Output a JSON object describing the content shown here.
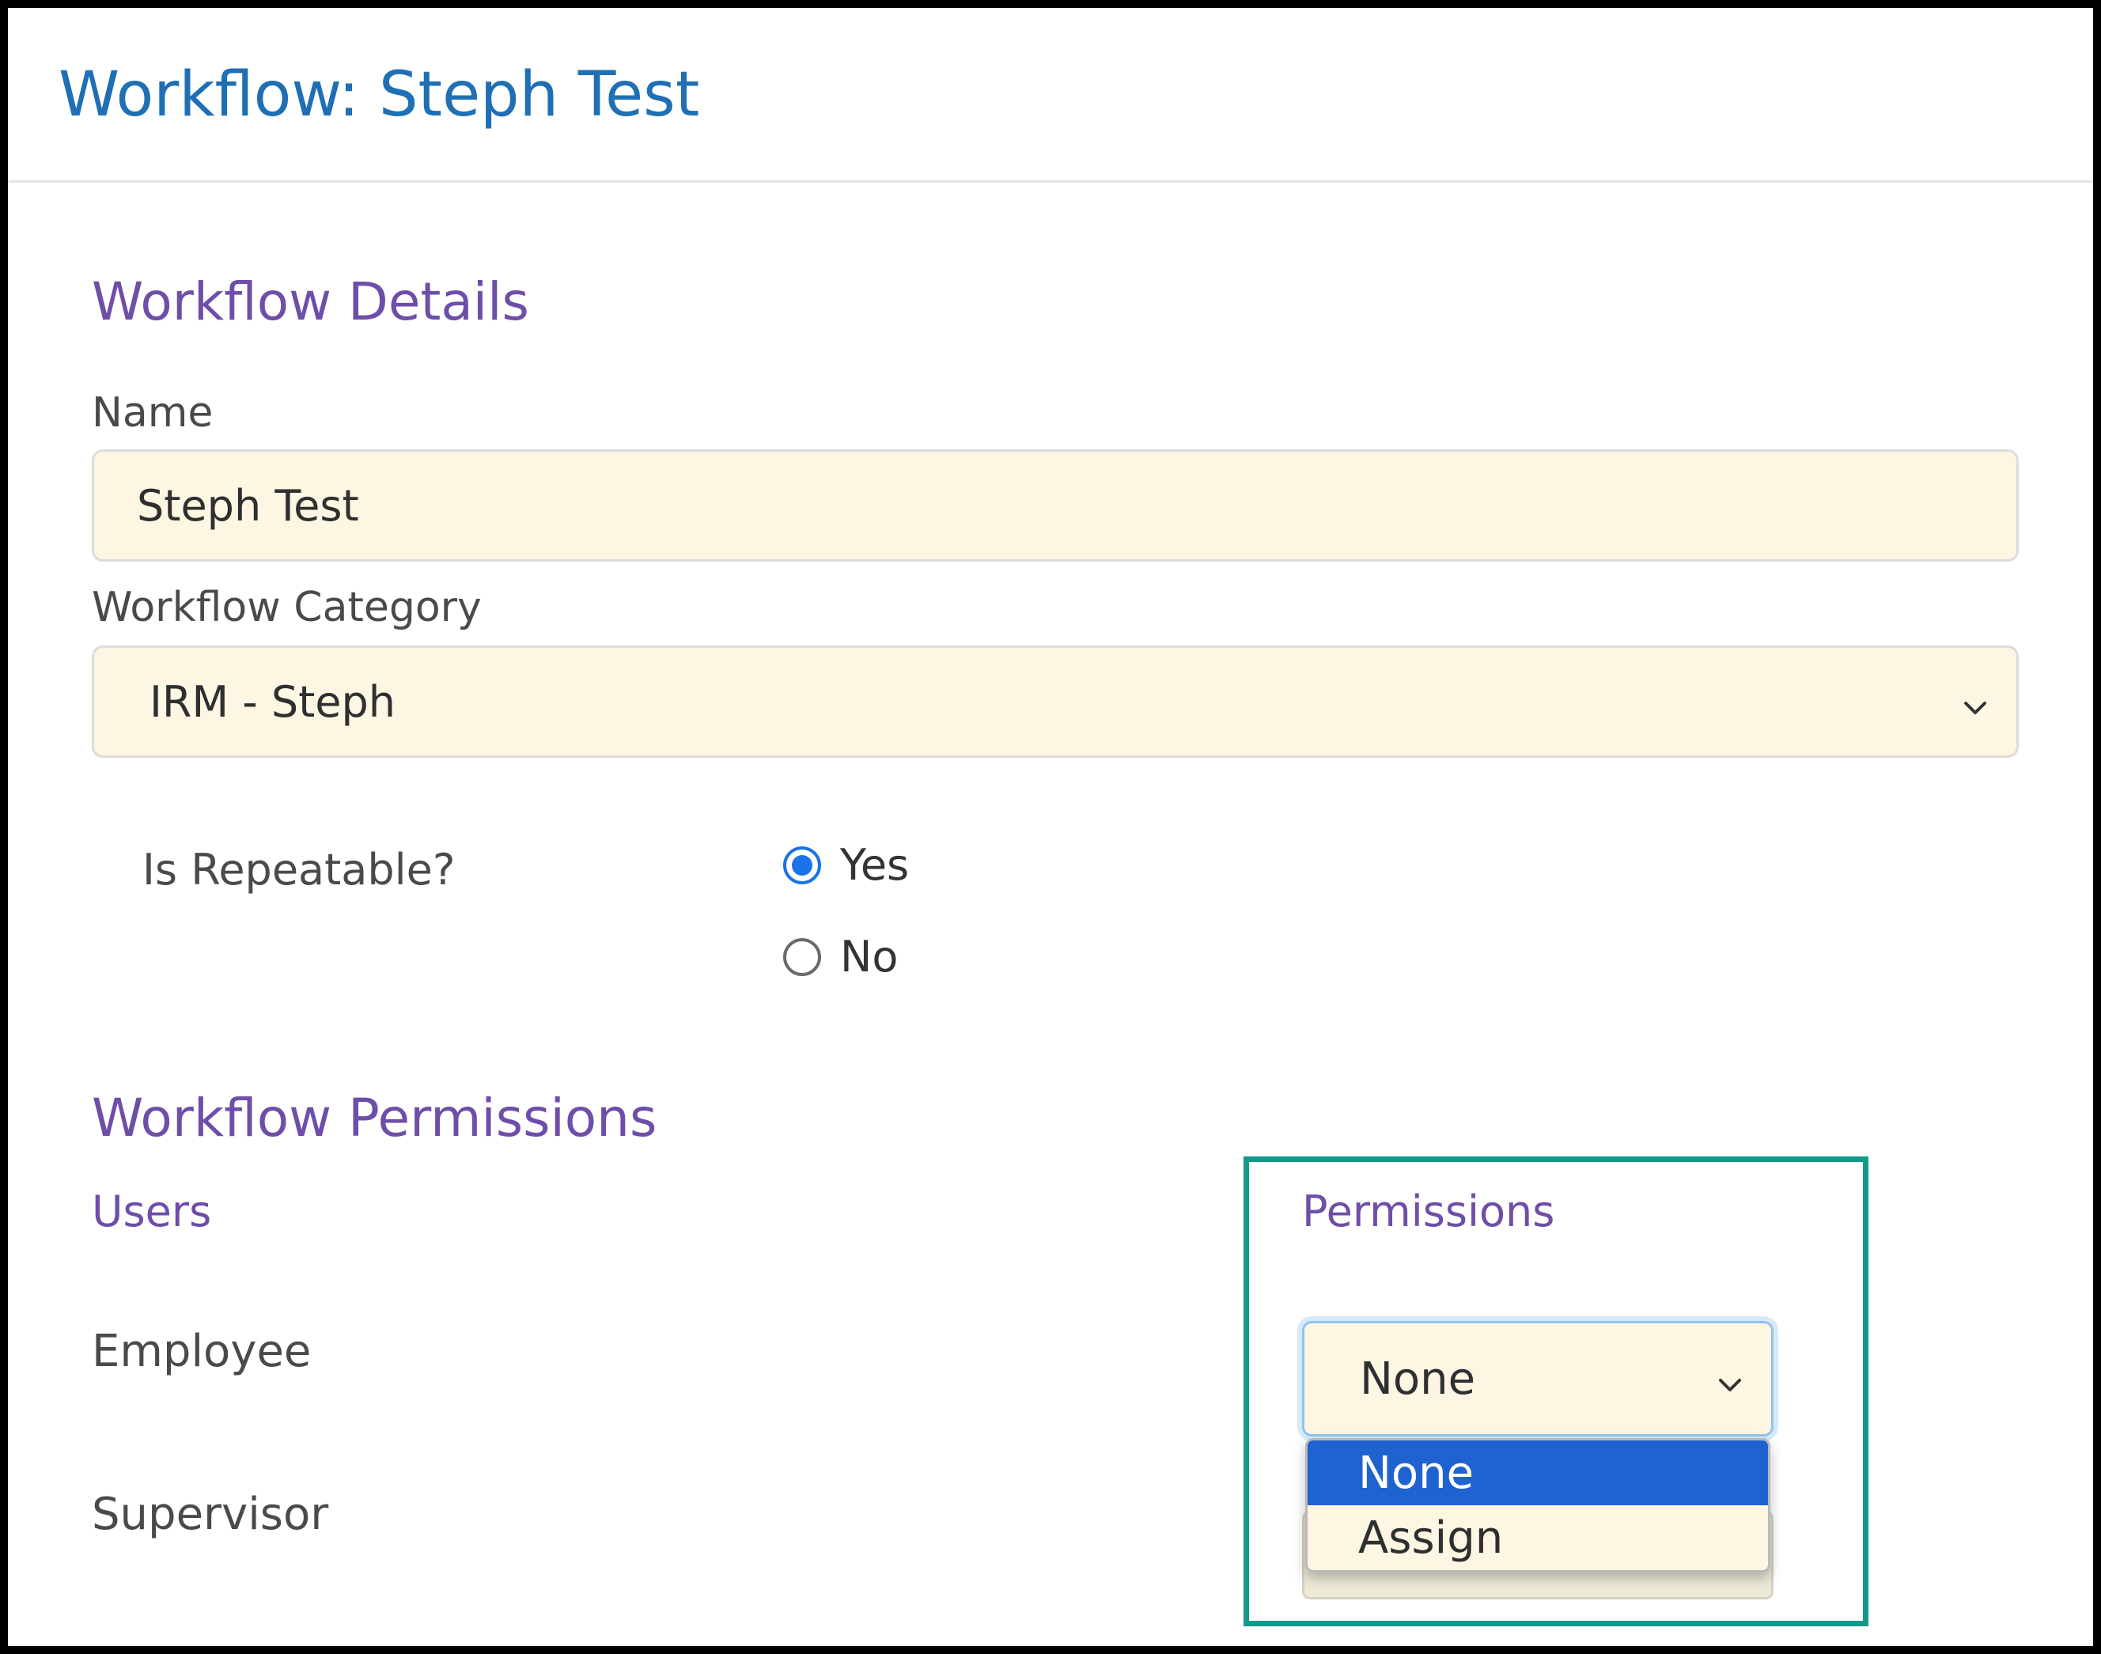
{
  "header": {
    "title": "Workflow: Steph Test"
  },
  "details": {
    "heading": "Workflow Details",
    "name_label": "Name",
    "name_value": "Steph Test",
    "category_label": "Workflow Category",
    "category_value": "IRM - Steph",
    "repeatable_label": "Is Repeatable?",
    "repeatable_options": [
      {
        "label": "Yes",
        "checked": true
      },
      {
        "label": "No",
        "checked": false
      }
    ]
  },
  "permissions": {
    "heading": "Workflow Permissions",
    "users_heading": "Users",
    "permissions_heading": "Permissions",
    "rows": [
      {
        "user": "Employee",
        "permission": "None"
      },
      {
        "user": "Supervisor"
      }
    ],
    "dropdown_options": [
      {
        "label": "None",
        "selected": true
      },
      {
        "label": "Assign",
        "selected": false
      }
    ]
  },
  "colors": {
    "title": "#1f6fb5",
    "section_heading": "#6e4ea8",
    "input_bg": "#fdf6e3",
    "radio_checked": "#1a73e8",
    "dropdown_selected": "#1e63d0",
    "highlight_border": "#139a8a"
  },
  "icons": {
    "select_chevron": "chevron-down-icon"
  }
}
